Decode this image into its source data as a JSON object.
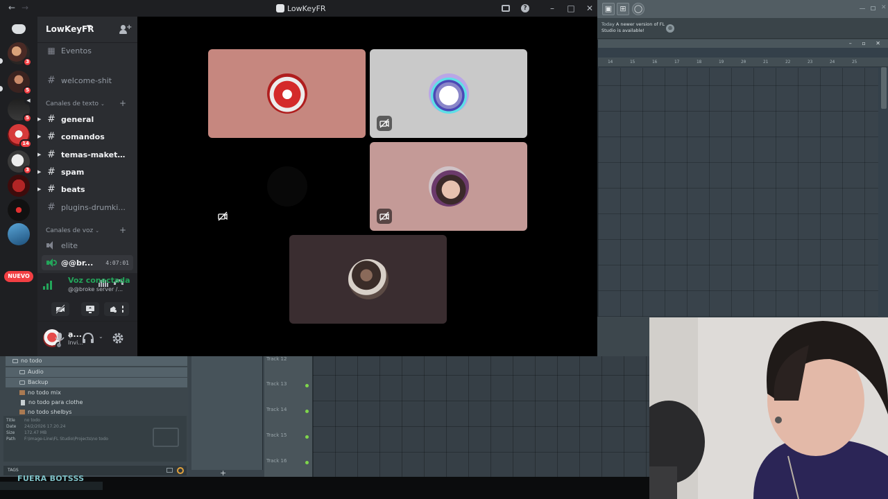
{
  "discord": {
    "window_title": "LowKeyFR",
    "server": {
      "name": "LowKeyFR",
      "events_label": "Eventos",
      "channels_top": [
        {
          "name": "welcome-shit",
          "unread": false
        }
      ],
      "text_category": "Canales de texto",
      "text_channels": [
        {
          "name": "general",
          "unread": true
        },
        {
          "name": "comandos",
          "unread": true
        },
        {
          "name": "temas-maketas",
          "unread": true
        },
        {
          "name": "spam",
          "unread": true
        },
        {
          "name": "beats",
          "unread": true
        },
        {
          "name": "plugins-drumki...",
          "unread": false
        }
      ],
      "voice_category": "Canales de voz",
      "voice_channels": [
        {
          "name": "elite"
        },
        {
          "name": "@@br...",
          "timer": "4:07:01",
          "active": true
        }
      ]
    },
    "rail": {
      "badges": [
        "3",
        "5",
        "5",
        "14",
        "3"
      ],
      "new_label": "NUEVO"
    },
    "voice_panel": {
      "status": "Voz conectada",
      "location": "@@broke server /..."
    },
    "user": {
      "name": "a...",
      "status": "Invi..."
    },
    "participants": [
      {
        "tile_color": "#c6877f",
        "camera_off_icon": false
      },
      {
        "tile_color": "#c9c9c9",
        "camera_off_icon": true
      },
      {
        "tile_color": "#000000",
        "camera_off_icon": true
      },
      {
        "tile_color": "#c49a97",
        "camera_off_icon": true
      },
      {
        "tile_color": "#3a2d30",
        "camera_off_icon": false
      }
    ]
  },
  "fl_studio": {
    "notice_prefix": "Today",
    "notice_text": "A newer version of FL Studio is available!",
    "ruler": [
      "14",
      "15",
      "16",
      "17",
      "18",
      "19",
      "20",
      "21",
      "22",
      "23",
      "24",
      "25"
    ],
    "tracks": [
      "Track 12",
      "Track 13",
      "Track 14",
      "Track 15",
      "Track 16"
    ],
    "browser": {
      "root_folder": "no todo",
      "folders": [
        "Audio",
        "Backup"
      ],
      "files": [
        "no todo mix",
        "no todo para clothe",
        "no todo shelbys"
      ],
      "info": {
        "title_label": "Title",
        "title": "no todo",
        "date_label": "Date",
        "date": "24/2/2026 17.20.24",
        "size_label": "Size",
        "size": "172.47 MB",
        "path_label": "Path",
        "path": "F:\\Image-Line\\FL Studio\\Projects\\no todo"
      },
      "tags_label": "TAGS"
    }
  },
  "overlay": {
    "banner_text": "FUERA BOTSSS"
  }
}
